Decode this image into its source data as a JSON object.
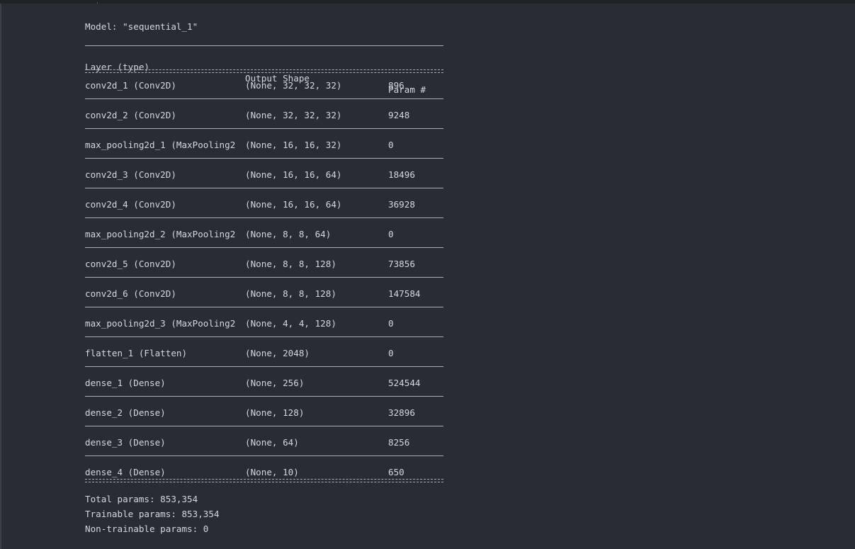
{
  "model": {
    "header": "Model: \"sequential_1\"",
    "columns": {
      "layer": "Layer (type)",
      "shape": "Output Shape",
      "params": "Param #"
    },
    "layers": [
      {
        "name": "conv2d_1 (Conv2D)",
        "shape": "(None, 32, 32, 32)",
        "params": "896"
      },
      {
        "name": "conv2d_2 (Conv2D)",
        "shape": "(None, 32, 32, 32)",
        "params": "9248"
      },
      {
        "name": "max_pooling2d_1 (MaxPooling2",
        "shape": "(None, 16, 16, 32)",
        "params": "0"
      },
      {
        "name": "conv2d_3 (Conv2D)",
        "shape": "(None, 16, 16, 64)",
        "params": "18496"
      },
      {
        "name": "conv2d_4 (Conv2D)",
        "shape": "(None, 16, 16, 64)",
        "params": "36928"
      },
      {
        "name": "max_pooling2d_2 (MaxPooling2",
        "shape": "(None, 8, 8, 64)",
        "params": "0"
      },
      {
        "name": "conv2d_5 (Conv2D)",
        "shape": "(None, 8, 8, 128)",
        "params": "73856"
      },
      {
        "name": "conv2d_6 (Conv2D)",
        "shape": "(None, 8, 8, 128)",
        "params": "147584"
      },
      {
        "name": "max_pooling2d_3 (MaxPooling2",
        "shape": "(None, 4, 4, 128)",
        "params": "0"
      },
      {
        "name": "flatten_1 (Flatten)",
        "shape": "(None, 2048)",
        "params": "0"
      },
      {
        "name": "dense_1 (Dense)",
        "shape": "(None, 256)",
        "params": "524544"
      },
      {
        "name": "dense_2 (Dense)",
        "shape": "(None, 128)",
        "params": "32896"
      },
      {
        "name": "dense_3 (Dense)",
        "shape": "(None, 64)",
        "params": "8256"
      },
      {
        "name": "dense_4 (Dense)",
        "shape": "(None, 10)",
        "params": "650"
      }
    ],
    "totals": {
      "total": "Total params: 853,354",
      "trainable": "Trainable params: 853,354",
      "non_trainable": "Non-trainable params: 0"
    }
  }
}
